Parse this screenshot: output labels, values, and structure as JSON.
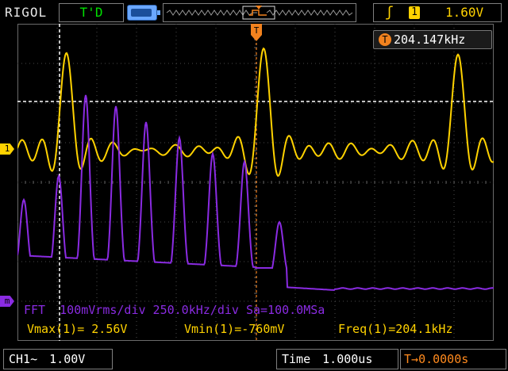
{
  "topbar": {
    "brand": "RIGOL",
    "status": "T'D",
    "trigger_channel": "1",
    "trigger_level": "1.60V",
    "trigger_slope_icon": "rising-edge-icon",
    "memory_icon": "memory-depth-icon"
  },
  "screen": {
    "freq_counter": "204.147kHz",
    "freq_icon_label": "T",
    "ch1_marker": "1",
    "math_marker": "m",
    "trigger_marker": "T"
  },
  "fft_line": "FFT  100mVrms/div 250.0kHz/div Sa=100.0MSa",
  "measurements": {
    "vmax": "Vmax(1)= 2.56V",
    "vmin": "Vmin(1)=-760mV",
    "freq": "Freq(1)=204.1kHz"
  },
  "bottombar": {
    "channel": "CH1~",
    "volts_div": "1.00V",
    "time_label": "Time",
    "time_div": "1.000us",
    "trig_offset_icon": "T",
    "trig_offset": "0.0000s"
  },
  "colors": {
    "ch1": "#ffd200",
    "math": "#8a2be2",
    "accent": "#f2821e"
  }
}
